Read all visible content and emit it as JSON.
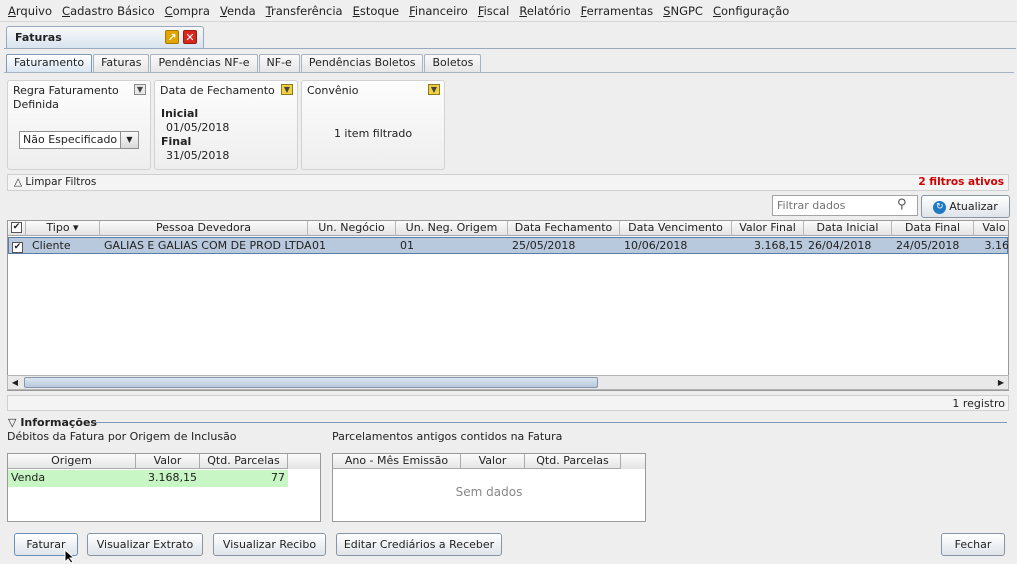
{
  "menu": [
    "Arquivo",
    "Cadastro Básico",
    "Compra",
    "Venda",
    "Transferência",
    "Estoque",
    "Financeiro",
    "Fiscal",
    "Relatório",
    "Ferramentas",
    "SNGPC",
    "Configuração"
  ],
  "window_tab": {
    "title": "Faturas"
  },
  "subtabs": [
    "Faturamento",
    "Faturas",
    "Pendências NF-e",
    "NF-e",
    "Pendências Boletos",
    "Boletos"
  ],
  "filters": {
    "regra": {
      "label": "Regra Faturamento Definida",
      "value": "Não Especificado"
    },
    "data_fechamento": {
      "label": "Data de Fechamento",
      "inicial_label": "Inicial",
      "inicial": "01/05/2018",
      "final_label": "Final",
      "final": "31/05/2018"
    },
    "convenio": {
      "label": "Convênio",
      "value": "1 item filtrado"
    }
  },
  "clear_filters": "Limpar Filtros",
  "active_filters": "2 filtros ativos",
  "search": {
    "placeholder": "Filtrar dados"
  },
  "refresh_label": "Atualizar",
  "grid": {
    "columns": [
      "Tipo",
      "Pessoa Devedora",
      "Un. Negócio",
      "Un. Neg. Origem",
      "Data Fechamento",
      "Data Vencimento",
      "Valor Final",
      "Data Inicial",
      "Data Final",
      "Valo"
    ],
    "rows": [
      {
        "checked": "✔",
        "tipo": "Cliente",
        "pessoa": "GALIAS E GALIAS COM DE PROD LTDA",
        "un_negocio": "01",
        "un_origem": "01",
        "data_fechamento": "25/05/2018",
        "data_vencimento": "10/06/2018",
        "valor_final": "3.168,15",
        "data_inicial": "26/04/2018",
        "data_final": "24/05/2018",
        "valor": "3.16"
      }
    ]
  },
  "record_count": "1 registro",
  "info": {
    "header": "Informações",
    "left_title": "Débitos da Fatura por Origem de Inclusão",
    "left_columns": [
      "Origem",
      "Valor",
      "Qtd. Parcelas"
    ],
    "left_rows": [
      {
        "origem": "Venda",
        "valor": "3.168,15",
        "qtd": "77"
      }
    ],
    "right_title": "Parcelamentos antigos contidos na Fatura",
    "right_columns": [
      "Ano - Mês Emissão",
      "Valor",
      "Qtd. Parcelas"
    ],
    "right_empty": "Sem dados"
  },
  "buttons": {
    "faturar": "Faturar",
    "extrato": "Visualizar Extrato",
    "recibo": "Visualizar Recibo",
    "crediarios": "Editar Crediários a Receber",
    "fechar": "Fechar"
  }
}
